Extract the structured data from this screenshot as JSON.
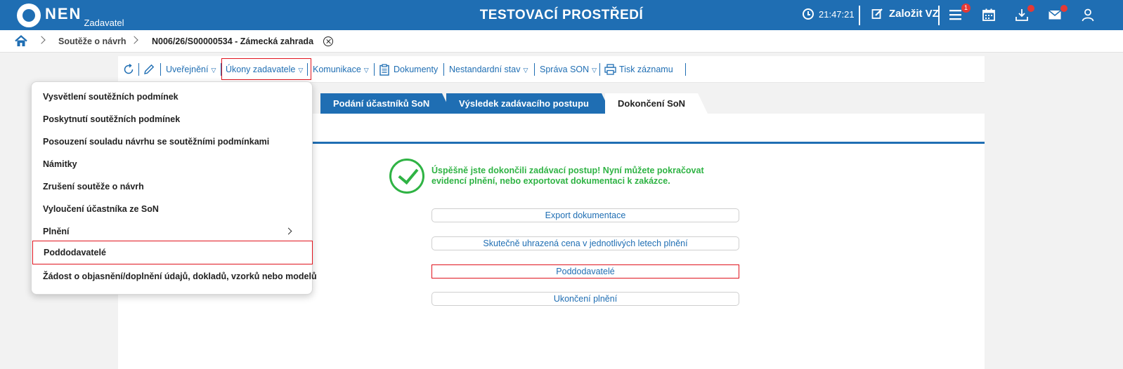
{
  "header": {
    "logo_text": "NEN",
    "logo_role": "Zadavatel",
    "environment_title": "TESTOVACÍ PROSTŘEDÍ",
    "clock": "21:47:21",
    "create_label": "Založit VZ",
    "menu_badge": "1"
  },
  "breadcrumb": {
    "items": [
      "Soutěže o návrh"
    ],
    "current": "N006/26/S00000534 - Zámecká zahrada"
  },
  "toolbar": {
    "uverejneni": "Uveřejnění",
    "ukony": "Úkony zadavatele",
    "komunikace": "Komunikace",
    "dokumenty": "Dokumenty",
    "nestandardni": "Nestandardní stav",
    "sprava": "Správa SON",
    "tisk": "Tisk záznamu",
    "dropdown_arrow": "▽"
  },
  "tabs": [
    {
      "label": "Podání účastníků SoN"
    },
    {
      "label": "Výsledek zadávacího postupu"
    },
    {
      "label": "Dokončení SoN"
    }
  ],
  "message": "Úspěšně jste dokončili zadávací postup! Nyní můžete pokračovat evidencí plnění, nebo exportovat dokumentaci k zakázce.",
  "actions": [
    {
      "label": "Export dokumentace"
    },
    {
      "label": "Skutečně uhrazená cena v jednotlivých letech plnění"
    },
    {
      "label": "Poddodavatelé"
    },
    {
      "label": "Ukončení plnění"
    }
  ],
  "dropdown": {
    "items": [
      {
        "label": "Vysvětlení soutěžních podmínek"
      },
      {
        "label": "Poskytnutí soutěžních podmínek"
      },
      {
        "label": "Posouzení souladu návrhu se soutěžními podmínkami"
      },
      {
        "label": "Námitky"
      },
      {
        "label": "Zrušení soutěže o návrh"
      },
      {
        "label": "Vyloučení účastníka ze SoN"
      },
      {
        "label": "Plnění"
      },
      {
        "label": "Poddodavatelé"
      },
      {
        "label": "Žádost o objasnění/doplnění údajů, dokladů, vzorků nebo modelů"
      }
    ]
  },
  "colors": {
    "primary": "#1f6eb3",
    "success": "#2fb344",
    "highlight": "#e0141e",
    "badge": "#e53935"
  }
}
